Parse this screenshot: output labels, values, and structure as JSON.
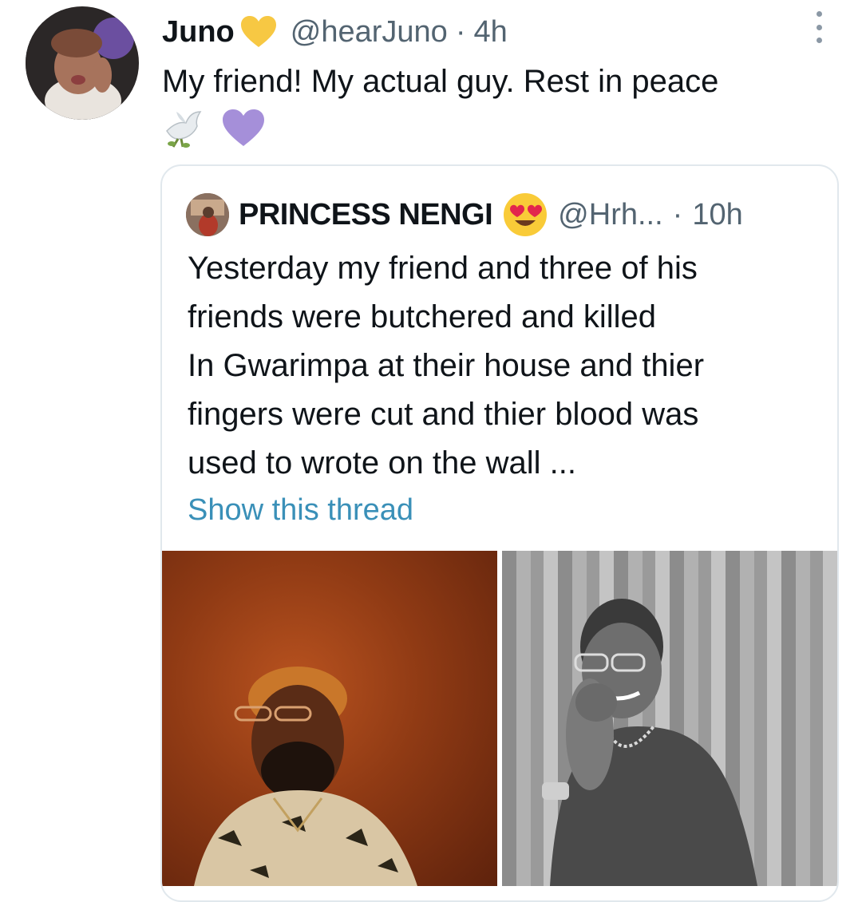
{
  "tweet": {
    "author_name": "Juno",
    "author_handle": "@hearJuno",
    "separator": "·",
    "time": "4h",
    "text": "My friend! My actual guy. Rest in peace",
    "emoji_icons": [
      "dove-icon",
      "purple-heart-icon"
    ],
    "name_badge_icon": "yellow-heart-icon",
    "more_icon": "more-vertical-icon"
  },
  "quoted_tweet": {
    "author_name": "PRINCESS NENGI",
    "name_emoji_icon": "heart-eyes-emoji-icon",
    "author_handle": "@Hrh...",
    "separator": "·",
    "time": "10h",
    "text": "Yesterday my friend and three of his\nfriends were butchered and killed\nIn Gwarimpa at their house and thier\nfingers were cut and thier blood was\nused to wrote on the wall ...",
    "show_thread_label": "Show this thread",
    "media": [
      "photo-man-orange-background",
      "photo-man-black-white"
    ]
  },
  "colors": {
    "text_primary": "#0f1419",
    "text_secondary": "#536471",
    "link": "#3a90b8",
    "yellow_heart": "#f7c843",
    "purple_heart": "#a58fd9",
    "card_border": "#e1e8ed"
  }
}
